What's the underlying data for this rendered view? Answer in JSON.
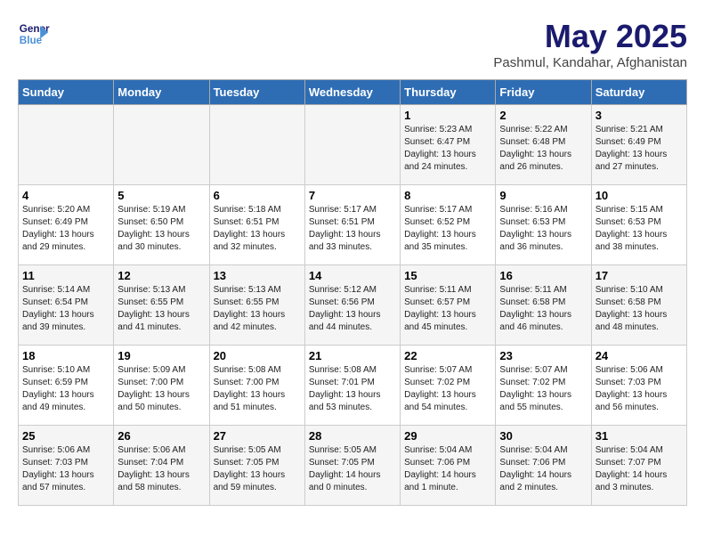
{
  "logo": {
    "line1": "General",
    "line2": "Blue"
  },
  "title": "May 2025",
  "subtitle": "Pashmul, Kandahar, Afghanistan",
  "days_of_week": [
    "Sunday",
    "Monday",
    "Tuesday",
    "Wednesday",
    "Thursday",
    "Friday",
    "Saturday"
  ],
  "weeks": [
    [
      {
        "day": "",
        "info": ""
      },
      {
        "day": "",
        "info": ""
      },
      {
        "day": "",
        "info": ""
      },
      {
        "day": "",
        "info": ""
      },
      {
        "day": "1",
        "info": "Sunrise: 5:23 AM\nSunset: 6:47 PM\nDaylight: 13 hours\nand 24 minutes."
      },
      {
        "day": "2",
        "info": "Sunrise: 5:22 AM\nSunset: 6:48 PM\nDaylight: 13 hours\nand 26 minutes."
      },
      {
        "day": "3",
        "info": "Sunrise: 5:21 AM\nSunset: 6:49 PM\nDaylight: 13 hours\nand 27 minutes."
      }
    ],
    [
      {
        "day": "4",
        "info": "Sunrise: 5:20 AM\nSunset: 6:49 PM\nDaylight: 13 hours\nand 29 minutes."
      },
      {
        "day": "5",
        "info": "Sunrise: 5:19 AM\nSunset: 6:50 PM\nDaylight: 13 hours\nand 30 minutes."
      },
      {
        "day": "6",
        "info": "Sunrise: 5:18 AM\nSunset: 6:51 PM\nDaylight: 13 hours\nand 32 minutes."
      },
      {
        "day": "7",
        "info": "Sunrise: 5:17 AM\nSunset: 6:51 PM\nDaylight: 13 hours\nand 33 minutes."
      },
      {
        "day": "8",
        "info": "Sunrise: 5:17 AM\nSunset: 6:52 PM\nDaylight: 13 hours\nand 35 minutes."
      },
      {
        "day": "9",
        "info": "Sunrise: 5:16 AM\nSunset: 6:53 PM\nDaylight: 13 hours\nand 36 minutes."
      },
      {
        "day": "10",
        "info": "Sunrise: 5:15 AM\nSunset: 6:53 PM\nDaylight: 13 hours\nand 38 minutes."
      }
    ],
    [
      {
        "day": "11",
        "info": "Sunrise: 5:14 AM\nSunset: 6:54 PM\nDaylight: 13 hours\nand 39 minutes."
      },
      {
        "day": "12",
        "info": "Sunrise: 5:13 AM\nSunset: 6:55 PM\nDaylight: 13 hours\nand 41 minutes."
      },
      {
        "day": "13",
        "info": "Sunrise: 5:13 AM\nSunset: 6:55 PM\nDaylight: 13 hours\nand 42 minutes."
      },
      {
        "day": "14",
        "info": "Sunrise: 5:12 AM\nSunset: 6:56 PM\nDaylight: 13 hours\nand 44 minutes."
      },
      {
        "day": "15",
        "info": "Sunrise: 5:11 AM\nSunset: 6:57 PM\nDaylight: 13 hours\nand 45 minutes."
      },
      {
        "day": "16",
        "info": "Sunrise: 5:11 AM\nSunset: 6:58 PM\nDaylight: 13 hours\nand 46 minutes."
      },
      {
        "day": "17",
        "info": "Sunrise: 5:10 AM\nSunset: 6:58 PM\nDaylight: 13 hours\nand 48 minutes."
      }
    ],
    [
      {
        "day": "18",
        "info": "Sunrise: 5:10 AM\nSunset: 6:59 PM\nDaylight: 13 hours\nand 49 minutes."
      },
      {
        "day": "19",
        "info": "Sunrise: 5:09 AM\nSunset: 7:00 PM\nDaylight: 13 hours\nand 50 minutes."
      },
      {
        "day": "20",
        "info": "Sunrise: 5:08 AM\nSunset: 7:00 PM\nDaylight: 13 hours\nand 51 minutes."
      },
      {
        "day": "21",
        "info": "Sunrise: 5:08 AM\nSunset: 7:01 PM\nDaylight: 13 hours\nand 53 minutes."
      },
      {
        "day": "22",
        "info": "Sunrise: 5:07 AM\nSunset: 7:02 PM\nDaylight: 13 hours\nand 54 minutes."
      },
      {
        "day": "23",
        "info": "Sunrise: 5:07 AM\nSunset: 7:02 PM\nDaylight: 13 hours\nand 55 minutes."
      },
      {
        "day": "24",
        "info": "Sunrise: 5:06 AM\nSunset: 7:03 PM\nDaylight: 13 hours\nand 56 minutes."
      }
    ],
    [
      {
        "day": "25",
        "info": "Sunrise: 5:06 AM\nSunset: 7:03 PM\nDaylight: 13 hours\nand 57 minutes."
      },
      {
        "day": "26",
        "info": "Sunrise: 5:06 AM\nSunset: 7:04 PM\nDaylight: 13 hours\nand 58 minutes."
      },
      {
        "day": "27",
        "info": "Sunrise: 5:05 AM\nSunset: 7:05 PM\nDaylight: 13 hours\nand 59 minutes."
      },
      {
        "day": "28",
        "info": "Sunrise: 5:05 AM\nSunset: 7:05 PM\nDaylight: 14 hours\nand 0 minutes."
      },
      {
        "day": "29",
        "info": "Sunrise: 5:04 AM\nSunset: 7:06 PM\nDaylight: 14 hours\nand 1 minute."
      },
      {
        "day": "30",
        "info": "Sunrise: 5:04 AM\nSunset: 7:06 PM\nDaylight: 14 hours\nand 2 minutes."
      },
      {
        "day": "31",
        "info": "Sunrise: 5:04 AM\nSunset: 7:07 PM\nDaylight: 14 hours\nand 3 minutes."
      }
    ]
  ]
}
